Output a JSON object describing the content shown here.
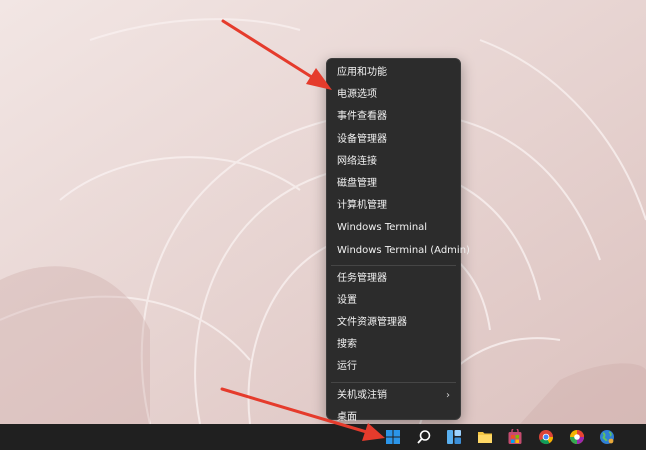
{
  "context_menu": {
    "items": [
      "应用和功能",
      "电源选项",
      "事件查看器",
      "设备管理器",
      "网络连接",
      "磁盘管理",
      "计算机管理",
      "Windows Terminal",
      "Windows Terminal (Admin)",
      "任务管理器",
      "设置",
      "文件资源管理器",
      "搜索",
      "运行",
      "关机或注销",
      "桌面"
    ]
  },
  "taskbar": {
    "icons": [
      "windows-start-icon",
      "search-icon",
      "widgets-icon",
      "file-explorer-icon",
      "store-icon",
      "chrome-icon",
      "browser-icon",
      "globe-icon"
    ]
  },
  "colors": {
    "menu_bg": "#2c2c2c",
    "taskbar_bg": "#202020",
    "arrow": "#e53b2c",
    "wallpaper": "#e7d4d2"
  }
}
